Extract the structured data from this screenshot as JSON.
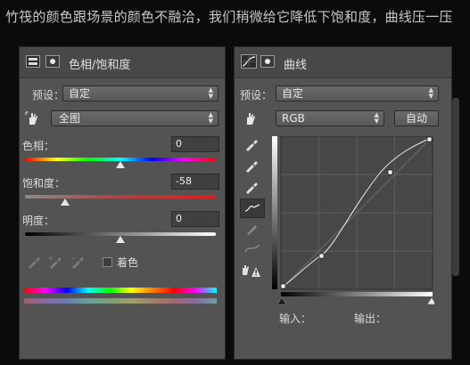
{
  "caption": "竹筏的颜色跟场景的颜色不融洽，我们稍微给它降低下饱和度，曲线压一压",
  "hue_sat_panel": {
    "title": "色相/饱和度",
    "preset_label": "预设：",
    "preset_value": "自定",
    "channel_value": "全图",
    "hue_label": "色相：",
    "hue_value": "0",
    "saturation_label": "饱和度：",
    "saturation_value": "-58",
    "lightness_label": "明度：",
    "lightness_value": "0",
    "colorize_label": "着色",
    "hue_level": 0.5,
    "saturation_level": 0.21,
    "lightness_level": 0.5
  },
  "curves_panel": {
    "title": "曲线",
    "preset_label": "预设：",
    "preset_value": "自定",
    "channel_value": "RGB",
    "auto_button": "自动",
    "input_label": "输入：",
    "output_label": "输出："
  },
  "icons": [
    "adjustment-layer-icon",
    "mask-icon",
    "hand-target-icon",
    "eyedropper-icon",
    "eyedropper-plus-icon",
    "eyedropper-minus-icon",
    "curve-tool-icon",
    "pencil-icon",
    "smooth-icon",
    "clipping-warning-icon"
  ]
}
